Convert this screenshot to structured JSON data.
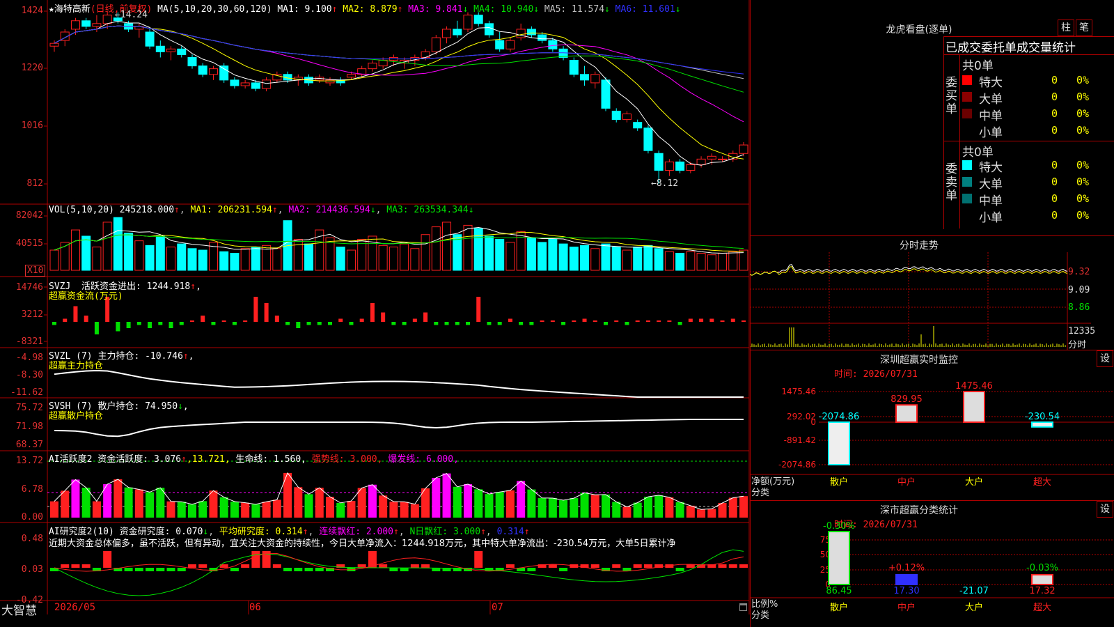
{
  "stock": {
    "star": "★",
    "name": "海特高新",
    "period": "(日线,前复权)",
    "ma_label": "MA(5,10,20,30,60,120)",
    "ma1": "MA1: 9.100",
    "ma2": "MA2: 8.879",
    "ma3": "MA3: 9.841",
    "ma4": "MA4: 10.940",
    "ma5": "MA5: 11.574",
    "ma6": "MA6: 11.601",
    "high_mark": "14.24",
    "low_mark": "8.12",
    "price_axis": [
      "1424",
      "1220",
      "1016",
      "812"
    ]
  },
  "vol": {
    "label": "VOL(5,10,20)",
    "value": "245218.000",
    "ma1": "MA1: 206231.594",
    "ma2": "MA2: 214436.594",
    "ma3": "MA3: 263534.344",
    "axis": [
      "82042",
      "40515"
    ],
    "unit": "X10"
  },
  "svzj": {
    "label": "SVZJ",
    "title": "活跃资金进出: 1244.918",
    "sub": "超赢资金流(万元)",
    "axis": [
      "14746",
      "3212",
      "-8321"
    ]
  },
  "svzl": {
    "label": "SVZL (7)",
    "title": "主力持仓: -10.746",
    "sub": "超赢主力持仓",
    "axis": [
      "-4.98",
      "-8.30",
      "-11.62"
    ]
  },
  "svsh": {
    "label": "SVSH (7)",
    "title": "散户持仓: 74.950",
    "sub": "超赢散户持仓",
    "axis": [
      "75.72",
      "71.98",
      "68.37"
    ]
  },
  "ai1": {
    "label": "AI活跃度2",
    "t1": "资金活跃度: 3.076",
    "t2": ",13.721,",
    "t3": "生命线: 1.560,",
    "t4": "强势线: 3.000,",
    "t5": "爆发线: 6.000,",
    "axis": [
      "13.72",
      "6.78",
      "0.00"
    ]
  },
  "ai2": {
    "label": "AI研究度2(10)",
    "t1": "资金研究度: 0.070",
    "t2": "平均研究度: 0.314",
    "t3": "连续飘红: 2.000",
    "t4": "N日飘红: 3.000",
    "t5": "0.314",
    "comment": "近期大资金总体偏多，虽不活跃，但有异动，宜关注大资金的持续性，今日大单净流入：1244.918万元，其中特大单净流出：-230.54万元，大单5日累计净",
    "axis": [
      "0.48",
      "0.03",
      "-0.42"
    ]
  },
  "footer": {
    "brand": "大智慧",
    "dates": [
      "2026/05",
      "06",
      "07"
    ]
  },
  "longhu": {
    "title": "龙虎看盘(逐单)",
    "tabs": [
      "柱",
      "笔"
    ],
    "header": "已成交委托单成交量统计",
    "buy_label": "委买单",
    "sell_label": "委卖单",
    "buy_total": "共0单",
    "sell_total": "共0单",
    "rows": [
      "特大",
      "大单",
      "中单",
      "小单"
    ],
    "count": "0",
    "pct": "0%"
  },
  "fenshi": {
    "title": "分时走势",
    "axis": [
      "9.32",
      "9.09",
      "8.86"
    ],
    "vol_axis": "12335",
    "vol_label": "分时"
  },
  "sz_monitor": {
    "title": "深圳超赢实时监控",
    "time": "时间: 2026/07/31",
    "settings": "设",
    "axis": [
      "1475.46",
      "292.02",
      "0",
      "-891.42",
      "-2074.86"
    ],
    "ylabel": "净额(万元)",
    "xlabel": "分类",
    "categories": [
      "散户",
      "中户",
      "大户",
      "超大"
    ],
    "values": [
      "-2074.86",
      "829.95",
      "1475.46",
      "-230.54"
    ]
  },
  "sz_class": {
    "title": "深市超赢分类统计",
    "time": "时间: 2026/07/31",
    "settings": "设",
    "axis": [
      "75",
      "50",
      "25",
      "0"
    ],
    "ylabel": "比例%",
    "xlabel": "分类",
    "categories": [
      "散户",
      "中户",
      "大户",
      "超大"
    ],
    "top_labels": [
      "-0.30%",
      "+0.12%",
      "",
      "-0.03%"
    ],
    "bottom_labels": [
      "86.45",
      "17.30",
      "-21.07",
      "17.32"
    ]
  },
  "colors": {
    "up": "#ff2020",
    "down": "#00ffff",
    "frame": "#b00000",
    "yellow": "#ffff00",
    "magenta": "#ff00ff",
    "green": "#00e000",
    "blue": "#3030ff"
  },
  "chart_data": [
    {
      "type": "candlestick",
      "title": "海特高新 (日线,前复权)",
      "x_labels": [
        "2026/05",
        "06",
        "07"
      ],
      "ylim": [
        8.12,
        14.24
      ],
      "ticks": [
        14.24,
        12.2,
        10.16,
        8.12
      ],
      "ohlc": [
        [
          13.0,
          13.2,
          12.8,
          13.1
        ],
        [
          13.2,
          13.6,
          13.0,
          13.5
        ],
        [
          13.6,
          14.0,
          13.4,
          13.9
        ],
        [
          13.9,
          14.0,
          13.6,
          13.7
        ],
        [
          13.7,
          14.1,
          13.5,
          13.8
        ],
        [
          13.8,
          14.24,
          13.6,
          14.1
        ],
        [
          14.0,
          14.2,
          13.8,
          13.9
        ],
        [
          13.8,
          13.9,
          13.5,
          13.6
        ],
        [
          13.6,
          13.8,
          13.3,
          13.7
        ],
        [
          13.5,
          13.6,
          12.9,
          13.0
        ],
        [
          13.0,
          13.2,
          12.6,
          12.8
        ],
        [
          12.8,
          13.0,
          12.5,
          12.9
        ],
        [
          12.9,
          13.0,
          12.6,
          12.7
        ],
        [
          12.6,
          12.7,
          12.2,
          12.3
        ],
        [
          12.3,
          12.4,
          11.9,
          12.0
        ],
        [
          12.0,
          12.3,
          11.8,
          12.2
        ],
        [
          12.3,
          12.4,
          11.7,
          11.8
        ],
        [
          11.8,
          11.9,
          11.5,
          11.6
        ],
        [
          11.6,
          11.8,
          11.5,
          11.7
        ],
        [
          11.7,
          11.8,
          11.4,
          11.5
        ],
        [
          11.5,
          11.9,
          11.4,
          11.8
        ],
        [
          11.8,
          12.1,
          11.7,
          12.0
        ],
        [
          12.0,
          12.1,
          11.7,
          11.8
        ],
        [
          11.8,
          12.0,
          11.6,
          11.9
        ],
        [
          11.9,
          12.0,
          11.6,
          11.7
        ],
        [
          11.8,
          12.0,
          11.7,
          11.9
        ],
        [
          11.7,
          11.9,
          11.6,
          11.8
        ],
        [
          11.8,
          11.9,
          11.6,
          11.7
        ],
        [
          11.9,
          12.1,
          11.8,
          12.0
        ],
        [
          12.0,
          12.3,
          11.9,
          12.2
        ],
        [
          12.2,
          12.5,
          12.1,
          12.4
        ],
        [
          12.3,
          12.6,
          12.2,
          12.5
        ],
        [
          12.5,
          12.7,
          12.3,
          12.6
        ],
        [
          12.4,
          12.6,
          12.2,
          12.5
        ],
        [
          12.5,
          12.7,
          12.3,
          12.6
        ],
        [
          12.6,
          12.9,
          12.5,
          12.8
        ],
        [
          12.8,
          13.4,
          12.7,
          13.3
        ],
        [
          13.3,
          13.7,
          13.1,
          13.6
        ],
        [
          13.6,
          13.9,
          13.3,
          13.4
        ],
        [
          13.6,
          14.2,
          13.5,
          14.1
        ],
        [
          14.1,
          14.2,
          13.7,
          13.8
        ],
        [
          13.8,
          13.9,
          13.3,
          13.4
        ],
        [
          13.2,
          13.5,
          12.8,
          12.9
        ],
        [
          12.9,
          13.3,
          12.8,
          13.2
        ],
        [
          13.3,
          13.8,
          13.2,
          13.6
        ],
        [
          13.6,
          13.7,
          13.3,
          13.4
        ],
        [
          13.4,
          13.5,
          13.1,
          13.2
        ],
        [
          13.2,
          13.3,
          12.8,
          12.9
        ],
        [
          12.9,
          13.0,
          12.5,
          12.6
        ],
        [
          12.5,
          12.6,
          11.9,
          12.0
        ],
        [
          12.0,
          12.3,
          11.6,
          11.8
        ],
        [
          11.7,
          12.1,
          11.5,
          12.0
        ],
        [
          11.8,
          11.9,
          10.7,
          10.8
        ],
        [
          10.7,
          10.8,
          10.3,
          10.4
        ],
        [
          10.4,
          10.7,
          10.3,
          10.6
        ],
        [
          10.3,
          10.4,
          10.0,
          10.1
        ],
        [
          10.1,
          10.2,
          9.2,
          9.3
        ],
        [
          9.2,
          9.3,
          8.12,
          8.6
        ],
        [
          8.6,
          9.0,
          8.4,
          8.9
        ],
        [
          8.9,
          9.0,
          8.5,
          8.6
        ],
        [
          8.6,
          8.9,
          8.5,
          8.8
        ],
        [
          8.8,
          9.1,
          8.7,
          9.0
        ],
        [
          9.0,
          9.2,
          8.8,
          9.1
        ],
        [
          9.0,
          9.1,
          8.9,
          9.0
        ],
        [
          9.0,
          9.3,
          8.9,
          9.2
        ],
        [
          9.2,
          9.6,
          9.1,
          9.5
        ]
      ]
    },
    {
      "type": "bar",
      "title": "VOL(5,10,20)",
      "ylim": [
        0,
        82042
      ],
      "values": [
        26,
        36,
        52,
        44,
        30,
        62,
        68,
        48,
        38,
        32,
        44,
        30,
        34,
        28,
        26,
        36,
        24,
        22,
        28,
        30,
        32,
        28,
        64,
        40,
        34,
        52,
        42,
        30,
        26,
        40,
        44,
        32,
        30,
        34,
        28,
        46,
        56,
        62,
        46,
        58,
        54,
        44,
        40,
        36,
        50,
        42,
        36,
        40,
        34,
        30,
        32,
        28,
        34,
        30,
        26,
        30,
        32,
        28,
        24,
        22,
        24,
        22,
        20,
        22,
        24,
        26
      ]
    },
    {
      "type": "bar",
      "title": "SVZJ 活跃资金进出",
      "ylim": [
        -8321,
        14746
      ],
      "values": [
        -1,
        1,
        5,
        2,
        -4,
        8,
        -3,
        -2,
        -1,
        -2,
        -1,
        -2,
        -1,
        0,
        2,
        -1,
        0,
        -1,
        0,
        8,
        6,
        2,
        -1,
        -2,
        -1,
        -1,
        -1,
        1,
        -1,
        1,
        6,
        3,
        -1,
        -1,
        1,
        3,
        -1,
        -1,
        -1,
        -1,
        8,
        -1,
        -1,
        1,
        -1,
        -1,
        0,
        0,
        -1,
        0,
        1,
        0,
        -1,
        0,
        -1,
        0,
        0,
        0,
        0,
        -1,
        1,
        1,
        1,
        0,
        1,
        0
      ]
    }
  ]
}
